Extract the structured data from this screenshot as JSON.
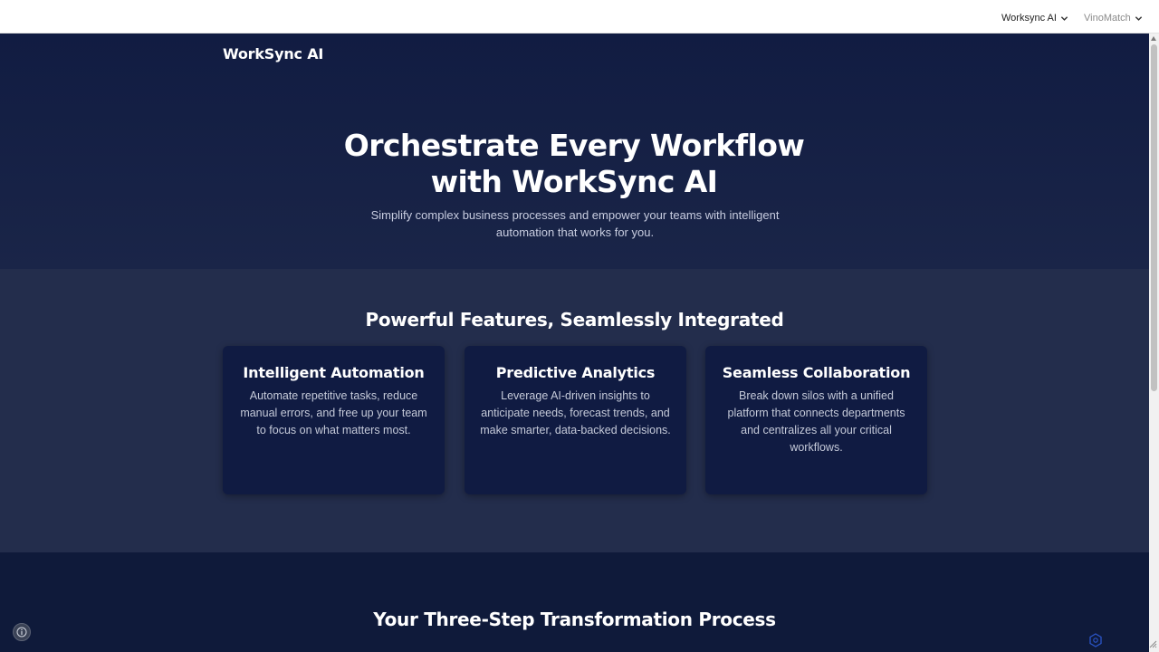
{
  "topbar": {
    "nav": [
      {
        "label": "Worksync AI"
      },
      {
        "label": "VinoMatch"
      }
    ]
  },
  "hero": {
    "brand": "WorkSync AI",
    "title_line1": "Orchestrate Every Workflow",
    "title_line2": "with WorkSync AI",
    "subtitle": "Simplify complex business processes and empower your teams with intelligent automation that works for you."
  },
  "features": {
    "title": "Powerful Features, Seamlessly Integrated",
    "cards": [
      {
        "title": "Intelligent Automation",
        "text": "Automate repetitive tasks, reduce manual errors, and free up your team to focus on what matters most."
      },
      {
        "title": "Predictive Analytics",
        "text": "Leverage AI-driven insights to anticipate needs, forecast trends, and make smarter, data-backed decisions."
      },
      {
        "title": "Seamless Collaboration",
        "text": "Break down silos with a unified platform that connects departments and centralizes all your critical workflows."
      }
    ]
  },
  "process": {
    "title": "Your Three-Step Transformation Process"
  },
  "icons": {
    "nav_dropdown": "chevron-down-icon",
    "info": "info-icon",
    "badge": "hexagon-logo-icon"
  },
  "colors": {
    "hero_bg": "#111c42",
    "features_bg": "#232d4c",
    "card_bg": "#101b42",
    "process_bg": "#0f1a3a",
    "heading_text": "#ffffff",
    "body_text": "#c5cad9"
  }
}
